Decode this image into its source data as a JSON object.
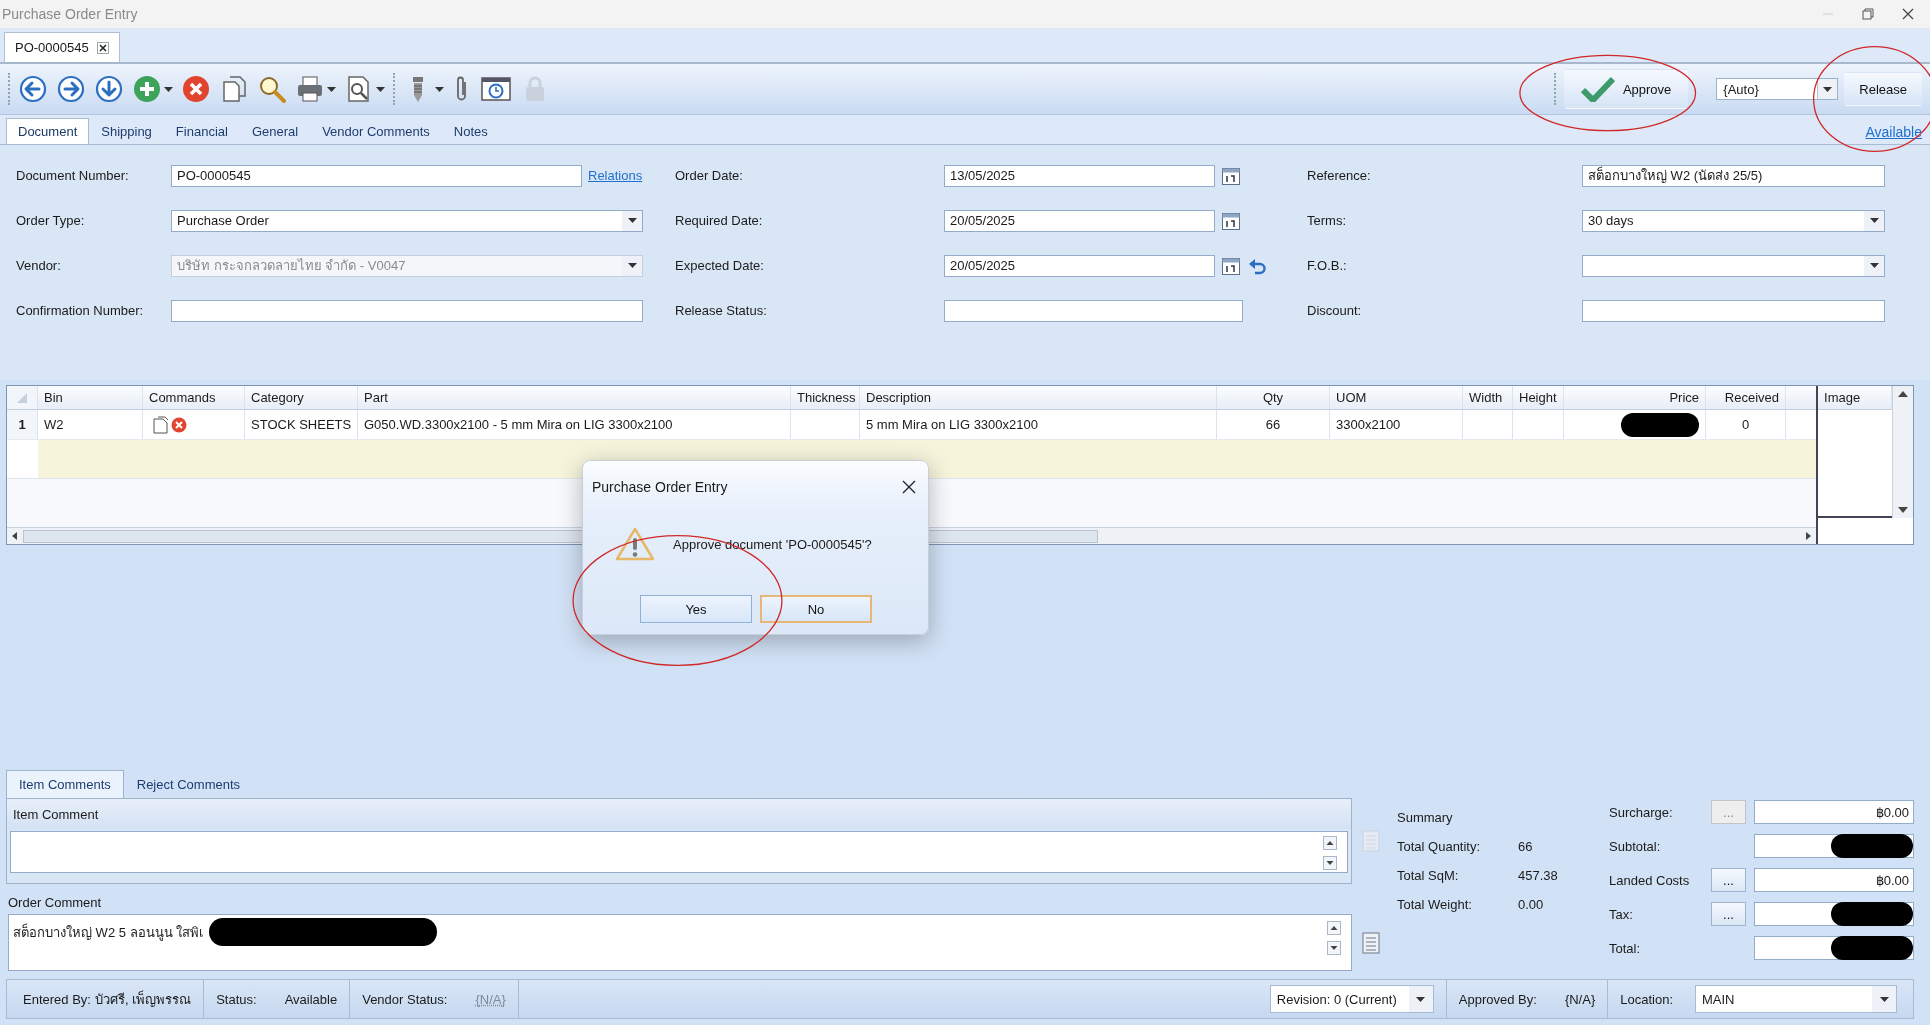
{
  "window": {
    "title": "Purchase Order Entry"
  },
  "document_tabs": [
    {
      "label": "PO-0000545",
      "selected": true
    }
  ],
  "toolbar": {
    "approve": {
      "label": "Approve",
      "circled": true
    },
    "numbering": {
      "value": "{Auto}"
    },
    "release": {
      "label": "Release",
      "circled": true
    }
  },
  "tabs": [
    {
      "label": "Document",
      "selected": true
    },
    {
      "label": "Shipping",
      "selected": false
    },
    {
      "label": "Financial",
      "selected": false
    },
    {
      "label": "General",
      "selected": false
    },
    {
      "label": "Vendor Comments",
      "selected": false
    },
    {
      "label": "Notes",
      "selected": false
    }
  ],
  "availability_link": "Available",
  "form": {
    "columns": [
      {
        "fields": [
          {
            "label": "Document Number:",
            "kind": "text",
            "value": "PO-0000545",
            "link": "Relations",
            "disabled": false
          },
          {
            "label": "Order Type:",
            "kind": "combo",
            "value": "Purchase Order",
            "disabled": false
          },
          {
            "label": "Vendor:",
            "kind": "combo",
            "value": "บริษัท กระจกลวดลายไทย จำกัด - V0047",
            "disabled": true
          },
          {
            "label": "Confirmation Number:",
            "kind": "text",
            "disabled": false
          }
        ]
      },
      {
        "fields": [
          {
            "label": "Order Date:",
            "kind": "date",
            "value": "13/05/2025",
            "disabled": false
          },
          {
            "label": "Required Date:",
            "kind": "date",
            "value": "20/05/2025",
            "disabled": false
          },
          {
            "label": "Expected Date:",
            "kind": "date",
            "value": "20/05/2025",
            "has_reset": true,
            "disabled": false
          },
          {
            "label": "Release Status:",
            "kind": "text",
            "disabled": false
          }
        ]
      },
      {
        "fields": [
          {
            "label": "Reference:",
            "kind": "text",
            "value": "สต็อกบางใหญ่ W2 (นัดส่ง 25/5)",
            "disabled": false
          },
          {
            "label": "Terms:",
            "kind": "combo",
            "value": "30 days",
            "disabled": false
          },
          {
            "label": "F.O.B.:",
            "kind": "combo",
            "disabled": false
          },
          {
            "label": "Discount:",
            "kind": "text",
            "disabled": false
          }
        ]
      }
    ]
  },
  "grid": {
    "columns": [
      "Bin",
      "Commands",
      "Category",
      "Part",
      "Thickness",
      "Description",
      "Qty",
      "UOM",
      "Width",
      "Height",
      "Price",
      "Received"
    ],
    "image_column": "Image",
    "rows": [
      {
        "number": "1",
        "cells": [
          {
            "kind": "text",
            "text": "W2"
          },
          {
            "kind": "commands"
          },
          {
            "kind": "text",
            "text": "STOCK SHEETS"
          },
          {
            "kind": "text",
            "text": "G050.WD.3300x2100 - 5 mm Mira on LIG 3300x2100"
          },
          {
            "kind": "empty"
          },
          {
            "kind": "text",
            "text": "5 mm Mira on LIG 3300x2100"
          },
          {
            "kind": "text",
            "text": "66"
          },
          {
            "kind": "text",
            "text": "3300x2100"
          },
          {
            "kind": "empty"
          },
          {
            "kind": "empty"
          },
          {
            "kind": "redacted"
          },
          {
            "kind": "text",
            "text": "0"
          }
        ]
      }
    ]
  },
  "dialog": {
    "title": "Purchase Order Entry",
    "message": "Approve document 'PO-0000545'?",
    "buttons": [
      {
        "label": "Yes",
        "focused": false,
        "circled": true
      },
      {
        "label": "No",
        "focused": true,
        "circled": false
      }
    ]
  },
  "comment_tabs": [
    {
      "label": "Item Comments",
      "selected": true
    },
    {
      "label": "Reject Comments",
      "selected": false
    }
  ],
  "item_comment": {
    "title": "Item Comment"
  },
  "order_comment": {
    "title": "Order Comment",
    "text": "สต็อกบางใหญ่ W2   5 ลอนนูน ใสพิเ",
    "redacted": true
  },
  "summary": {
    "title": "Summary",
    "stats": [
      {
        "label": "Total Quantity:",
        "value": "66"
      },
      {
        "label": "Total SqM:",
        "value": "457.38"
      },
      {
        "label": "Total Weight:",
        "value": "0.00"
      }
    ],
    "totals": [
      {
        "label": "Surcharge:",
        "button": "...",
        "button_disabled": true,
        "value": "฿0.00",
        "redacted": false
      },
      {
        "label": "Subtotal:",
        "redacted": true
      },
      {
        "label": "Landed Costs",
        "button": "...",
        "button_disabled": false,
        "value": "฿0.00",
        "redacted": false
      },
      {
        "label": "Tax:",
        "button": "...",
        "button_disabled": false,
        "redacted": true
      },
      {
        "label": "Total:",
        "redacted": true
      }
    ]
  },
  "status_bar": [
    {
      "kind": "text",
      "label": "Entered By:",
      "value": "บัวศรี, เพ็ญพรรณ"
    },
    {
      "kind": "text",
      "label": "Status:",
      "value": "Available"
    },
    {
      "kind": "link",
      "label": "Vendor Status:",
      "value": "{N/A}"
    },
    {
      "kind": "combo",
      "value": "Revision: 0 (Current)"
    },
    {
      "kind": "text",
      "label": "Approved By:",
      "value": "{N/A}"
    },
    {
      "kind": "combo",
      "label": "Location:",
      "value": "MAIN"
    }
  ]
}
